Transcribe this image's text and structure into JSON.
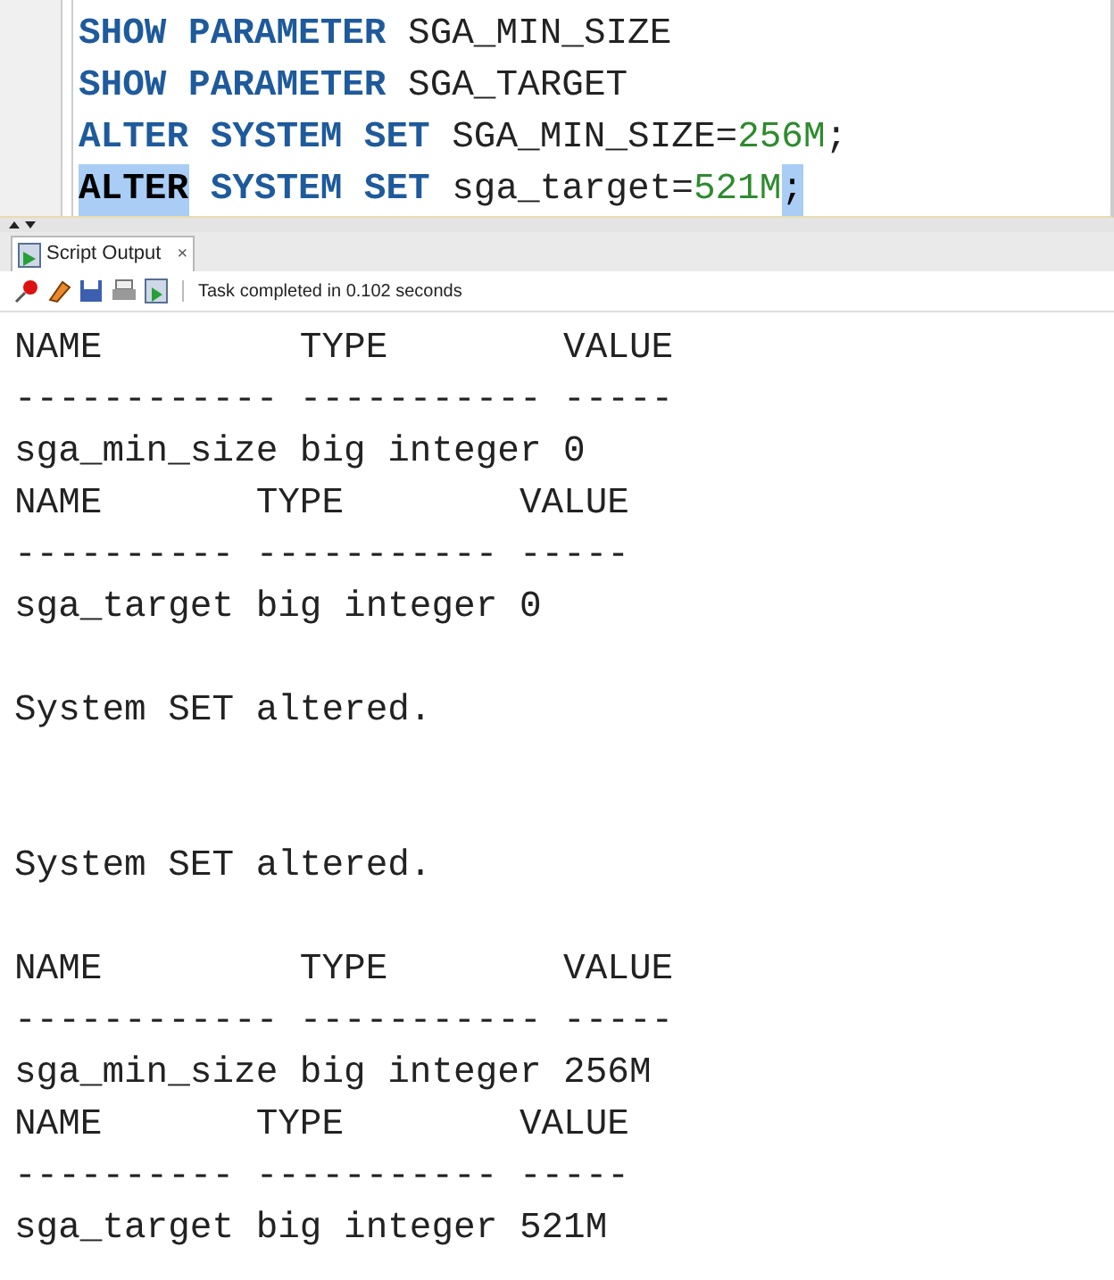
{
  "editor": {
    "lines": [
      [
        [
          {
            "kind": "keyword",
            "text": "SHOW",
            "highlighted": false
          }
        ],
        [
          {
            "kind": "keyword",
            "text": "PARAMETER",
            "highlighted": false
          }
        ],
        [
          {
            "kind": "ident",
            "text": "SGA_MIN_SIZE",
            "highlighted": false
          }
        ]
      ],
      [
        [
          {
            "kind": "keyword",
            "text": "SHOW",
            "highlighted": false
          }
        ],
        [
          {
            "kind": "keyword",
            "text": "PARAMETER",
            "highlighted": false
          }
        ],
        [
          {
            "kind": "ident",
            "text": "SGA_TARGET",
            "highlighted": false
          }
        ]
      ],
      [
        [
          {
            "kind": "keyword",
            "text": "ALTER",
            "highlighted": false
          }
        ],
        [
          {
            "kind": "keyword",
            "text": "SYSTEM",
            "highlighted": false
          }
        ],
        [
          {
            "kind": "keyword",
            "text": "SET",
            "highlighted": false
          }
        ],
        [
          {
            "kind": "ident",
            "text": "SGA_MIN_SIZE=",
            "highlighted": false
          },
          {
            "kind": "number",
            "text": "256M",
            "highlighted": false
          },
          {
            "kind": "ident",
            "text": ";",
            "highlighted": false
          }
        ]
      ],
      [
        [
          {
            "kind": "keyword",
            "text": "ALTER",
            "highlighted": true
          }
        ],
        [
          {
            "kind": "keyword",
            "text": "SYSTEM",
            "highlighted": false
          }
        ],
        [
          {
            "kind": "keyword",
            "text": "SET",
            "highlighted": false
          }
        ],
        [
          {
            "kind": "ident",
            "text": "sga_target=",
            "highlighted": false
          },
          {
            "kind": "number",
            "text": "521M",
            "highlighted": false
          },
          {
            "kind": "ident",
            "text": ";",
            "highlighted": true
          }
        ]
      ]
    ]
  },
  "output_tab": {
    "label": "Script Output",
    "close": "×",
    "selected": true
  },
  "toolbar": {
    "status": "Task completed in 0.102 seconds"
  },
  "output": {
    "lines": [
      {
        "kind": "text",
        "text": "NAME         TYPE        VALUE"
      },
      {
        "kind": "text",
        "text": "------------ ----------- -----"
      },
      {
        "kind": "text",
        "text": "sga_min_size big integer 0"
      },
      {
        "kind": "text",
        "text": "NAME       TYPE        VALUE"
      },
      {
        "kind": "text",
        "text": "---------- ----------- -----"
      },
      {
        "kind": "text",
        "text": "sga_target big integer 0"
      },
      {
        "kind": "blank"
      },
      {
        "kind": "text",
        "text": "System SET altered."
      },
      {
        "kind": "blank"
      },
      {
        "kind": "blank"
      },
      {
        "kind": "text",
        "text": "System SET altered."
      },
      {
        "kind": "blank"
      },
      {
        "kind": "text",
        "text": "NAME         TYPE        VALUE"
      },
      {
        "kind": "text",
        "text": "------------ ----------- -----"
      },
      {
        "kind": "text",
        "text": "sga_min_size big integer 256M"
      },
      {
        "kind": "text",
        "text": "NAME       TYPE        VALUE"
      },
      {
        "kind": "text",
        "text": "---------- ----------- -----"
      },
      {
        "kind": "text",
        "text": "sga_target big integer 521M"
      }
    ]
  }
}
